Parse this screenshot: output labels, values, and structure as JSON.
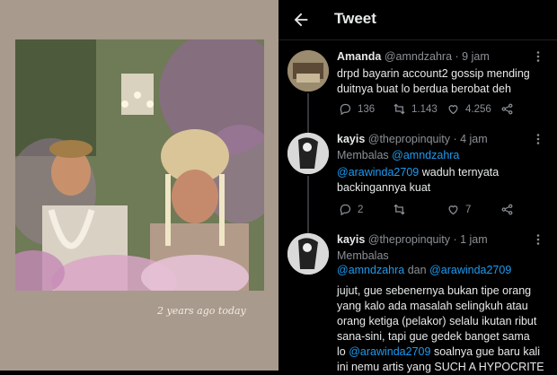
{
  "story": {
    "caption": "2 years ago today"
  },
  "twitter": {
    "header_title": "Tweet",
    "tweets": [
      {
        "name": "Amanda",
        "handle": "@amndzahra",
        "time": "· 9 jam",
        "body_lines": [
          "drpd bayarin account2 gossip mending",
          "duitnya buat lo berdua berobat deh"
        ],
        "replies": "136",
        "retweets": "1.143",
        "likes": "4.256"
      },
      {
        "name": "kayis",
        "handle": "@thepropinquity",
        "time": "· 4 jam",
        "reply_label": "Membalas",
        "reply_mention_1": "@amndzahra",
        "reply_mention_2": "@arawinda2709",
        "body_lines": [
          "waduh ternyata",
          "backingannya kuat"
        ],
        "replies": "2",
        "retweets": "",
        "likes": "7"
      },
      {
        "name": "kayis",
        "handle": "@thepropinquity",
        "time": "· 1 jam",
        "reply_label": "Membalas",
        "reply_mention_1": "@amndzahra",
        "reply_joiner": "dan",
        "reply_mention_2": "@arawinda2709",
        "body_lines": [
          "jujut, gue sebenernya bukan tipe orang",
          "yang kalo ada masalah selingkuh atau",
          "orang ketiga (pelakor) selalu ikutan ribut",
          "sana-sini, tapi gue gedek banget sama"
        ],
        "body_line5_prefix": "lo",
        "body_line5_mention": "@arawinda2709",
        "body_line5_suffix": "soalnya gue baru kali",
        "body_line6": "ini nemu artis yang SUCH A HYPOCRITE"
      }
    ]
  },
  "colors": {
    "accent": "#1d9bf0",
    "muted": "#8b9096",
    "text": "#e7e9ea",
    "background": "#000000",
    "story_background": "#a89a8c"
  }
}
